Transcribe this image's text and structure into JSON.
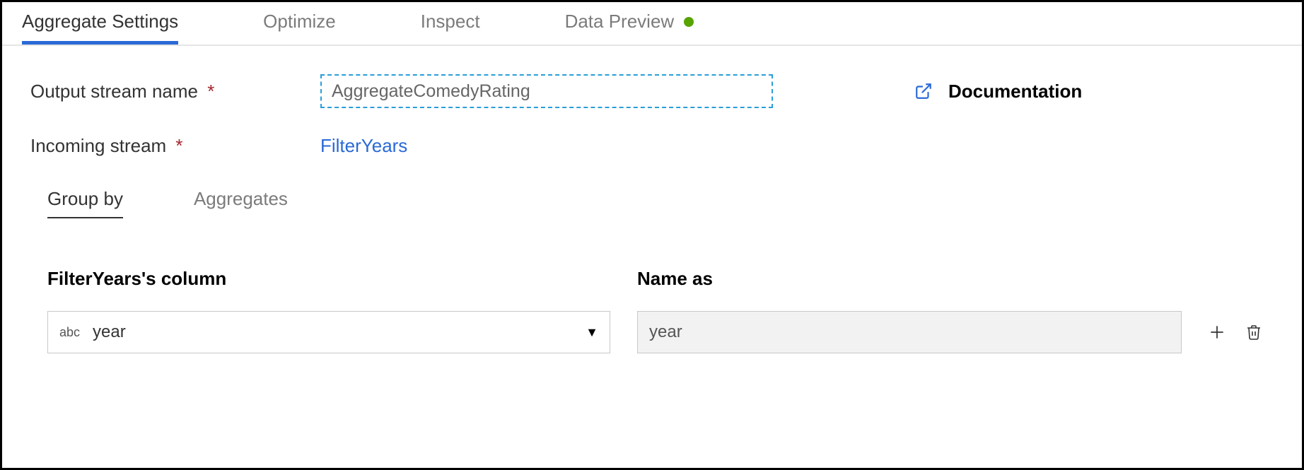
{
  "tabs": {
    "aggregate_settings": "Aggregate Settings",
    "optimize": "Optimize",
    "inspect": "Inspect",
    "data_preview": "Data Preview"
  },
  "form": {
    "output_stream_label": "Output stream name",
    "output_stream_value": "AggregateComedyRating",
    "incoming_stream_label": "Incoming stream",
    "incoming_stream_value": "FilterYears",
    "documentation_label": "Documentation"
  },
  "subtabs": {
    "group_by": "Group by",
    "aggregates": "Aggregates"
  },
  "columns": {
    "source_header": "FilterYears's column",
    "name_header": "Name as",
    "type_badge": "abc",
    "selected_column": "year",
    "name_as_value": "year"
  }
}
